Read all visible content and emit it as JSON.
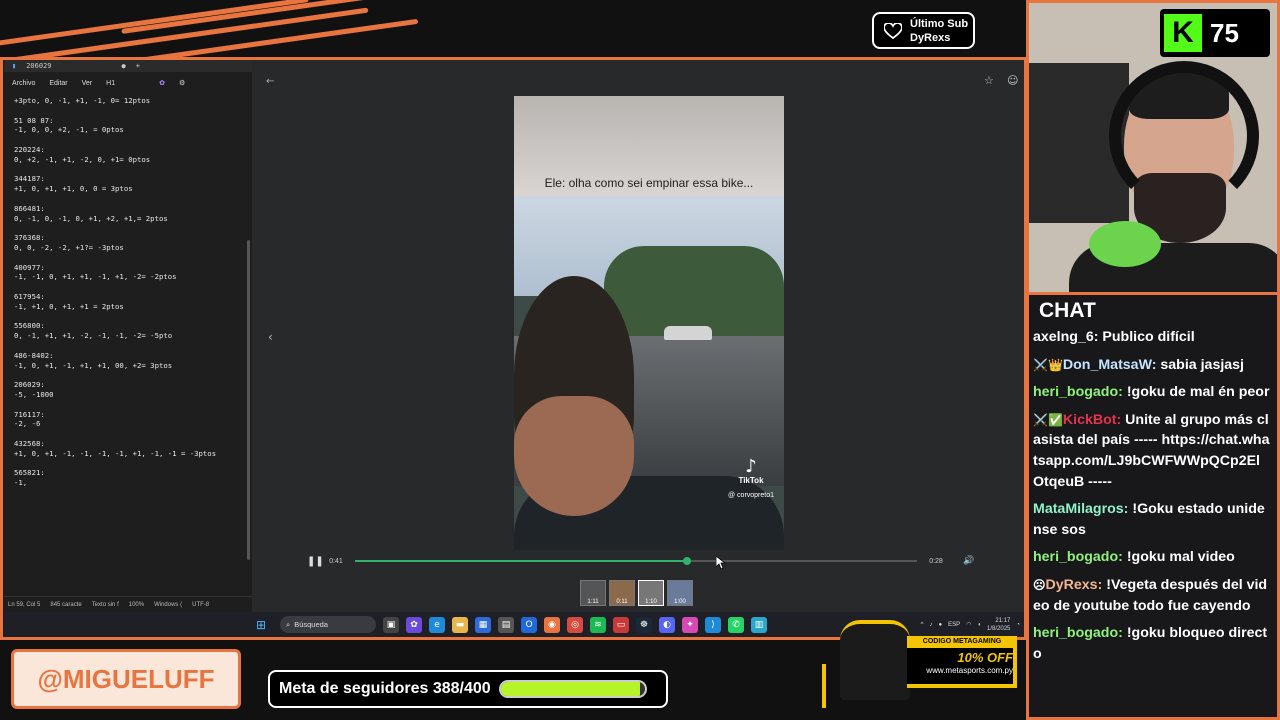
{
  "overlay": {
    "last_sub": {
      "title": "Último Sub",
      "name": "DyRexs"
    },
    "kick_badge": {
      "count": "75",
      "logo": "K"
    },
    "handle": "@MIGUELUFF",
    "follower_goal": {
      "label": "Meta de seguidores 388/400",
      "current": 388,
      "target": 400
    },
    "promo": {
      "code": "CODIGO METAGAMING",
      "discount": "10% OFF",
      "url": "www.metasports.com.py"
    }
  },
  "notepad": {
    "tab_title": "206029",
    "menu": [
      "Archivo",
      "Editar",
      "Ver",
      "H1"
    ],
    "lines": [
      "+3pto, 0, -1, +1, -1, 0= 12ptos",
      "",
      "51 08 87:",
      "-1, 0, 0, +2, -1, = 0ptos",
      "",
      "220224:",
      "0, +2, -1, +1, -2, 0, +1= 0ptos",
      "",
      "344187:",
      "+1, 0, +1, +1, 0, 0 = 3ptos",
      "",
      "866481:",
      "0, -1, 0, -1, 0, +1, +2, +1,= 2ptos",
      "",
      "376368:",
      "0, 0, -2, -2, +1?= -3ptos",
      "",
      "400977:",
      "-1, -1, 0, +1, +1, -1, +1, -2= -2ptos",
      "",
      "617954:",
      "-1, +1, 0, +1, +1 = 2ptos",
      "",
      "556800:",
      "0, -1, +1, +1, -2, -1, -1, -2= -5pto",
      "",
      "486-8402:",
      "-1, 0, +1, -1, +1, +1, 00, +2= 3ptos",
      "",
      "206029:",
      "-5, -1000",
      "",
      "716117:",
      "-2, -6",
      "",
      "432568:",
      "+1, 0, +1, -1, -1, -1, -1, +1, -1, -1 = -3ptos",
      "",
      "565821:",
      "-1,"
    ],
    "status": [
      "Ln 59, Col 5",
      "845 caracte",
      "Texto sin f",
      "100%",
      "Windows (",
      "UTF-8"
    ]
  },
  "viewer": {
    "caption": "Ele: olha como sei empinar essa bike...",
    "tiktok_label": "TikTok",
    "tiktok_user": "@ corvopreto1",
    "current_time": "0:41",
    "duration": "0:28",
    "progress": 0.59,
    "thumbnails": [
      "1:11",
      "0:11",
      "1:10",
      "1:00"
    ]
  },
  "taskbar": {
    "search_placeholder": "Búsqueda",
    "lang": "ESP",
    "time": "21:17",
    "date": "1/8/2025"
  },
  "chat": {
    "title": "CHAT",
    "messages": [
      {
        "badges": "",
        "user": "axelng_6",
        "color": "#ffffff",
        "text": "Publico difícil"
      },
      {
        "badges": "⚔️👑",
        "user": "Don_MatsaW",
        "color": "#c7e4ff",
        "text": "sabia jasjasj"
      },
      {
        "badges": "",
        "user": "heri_bogado",
        "color": "#8ff27a",
        "text": "!goku de mal én peor"
      },
      {
        "badges": "⚔️✅",
        "user": "KickBot",
        "color": "#e5334f",
        "text": "Unite al grupo más clasista del país ----- https://chat.whatsapp.com/LJ9bCWFWWpQCp2ElOtqeuB -----"
      },
      {
        "badges": "",
        "user": "MataMilagros",
        "color": "#8ff2c8",
        "text": "!Goku estado unidense sos"
      },
      {
        "badges": "",
        "user": "heri_bogado",
        "color": "#8ff27a",
        "text": "!goku mal video"
      },
      {
        "badges": "☹",
        "user": "DyRexs",
        "color": "#f2b58f",
        "text": "!Vegeta después del video de youtube todo fue cayendo"
      },
      {
        "badges": "",
        "user": "heri_bogado",
        "color": "#8ff27a",
        "text": "!goku bloqueo directo"
      }
    ]
  }
}
